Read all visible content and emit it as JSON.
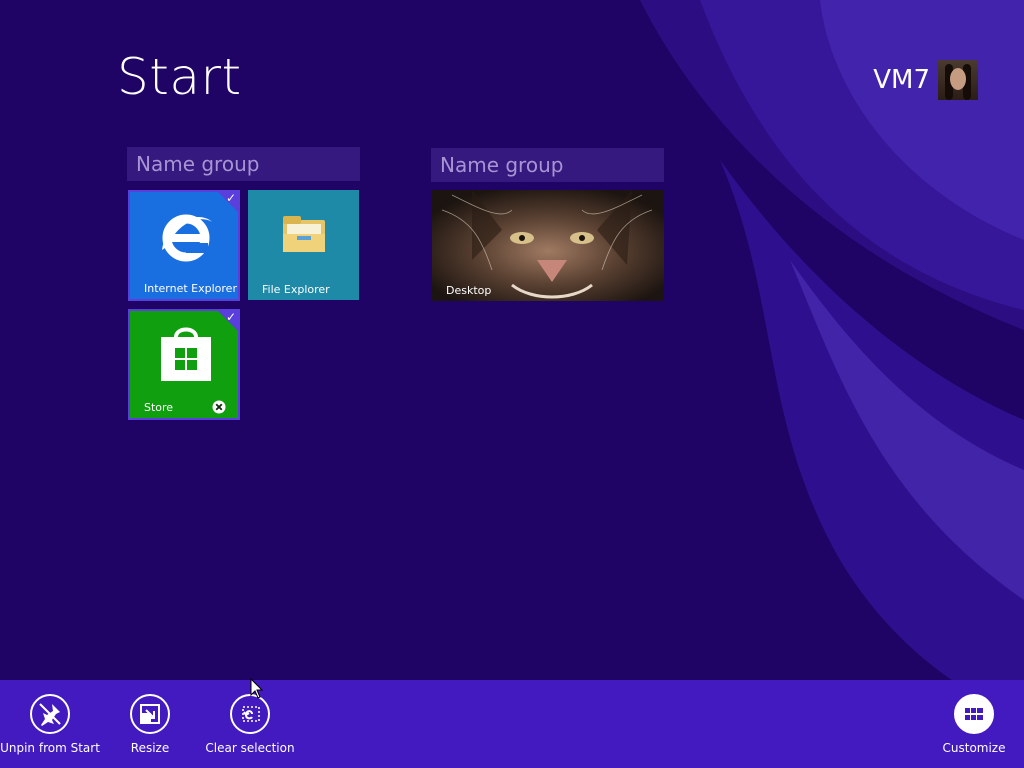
{
  "start": {
    "title": "Start"
  },
  "user": {
    "name": "VM7"
  },
  "groups": [
    {
      "placeholder": "Name group"
    },
    {
      "placeholder": "Name group"
    }
  ],
  "tiles": {
    "internet_explorer": {
      "label": "Internet Explorer",
      "color": "#1a6fe0",
      "selected": true
    },
    "file_explorer": {
      "label": "File Explorer",
      "color": "#1e8aa8",
      "selected": false
    },
    "desktop": {
      "label": "Desktop",
      "selected": false
    },
    "store": {
      "label": "Store",
      "color": "#0f9f0f",
      "selected": true
    }
  },
  "appbar": {
    "color": "#4319c0",
    "unpin_label": "Unpin from Start",
    "resize_label": "Resize",
    "clear_label": "Clear selection",
    "customize_label": "Customize"
  },
  "colors": {
    "background": "#1f0465",
    "accent": "#5b3fdc"
  }
}
